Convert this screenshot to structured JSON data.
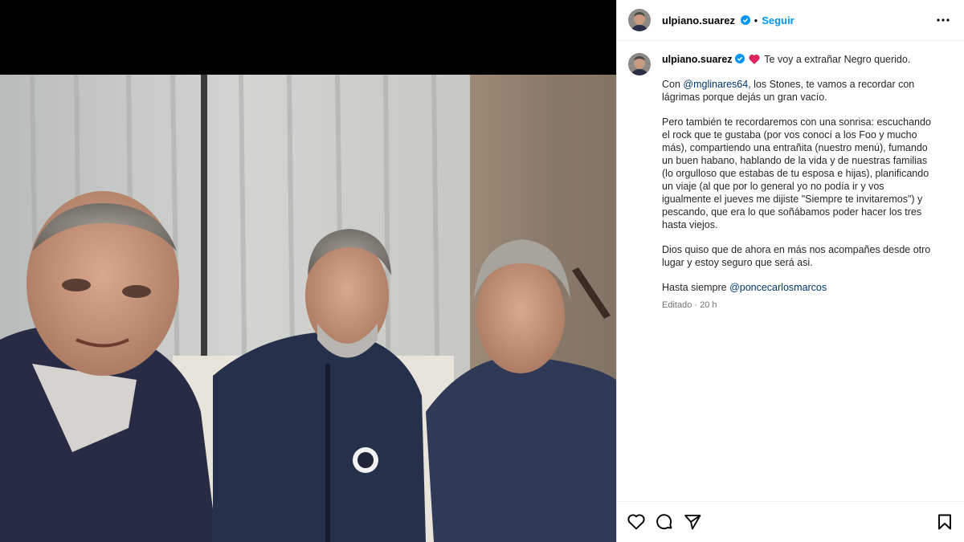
{
  "post": {
    "username": "ulpiano.suarez",
    "separator": "•",
    "follow_label": "Seguir",
    "caption": {
      "intro": "Te voy a extrañar Negro querido.",
      "p1_mention": "@mglinares64",
      "p1_rest": ", los Stones, te vamos a recordar con lágrimas porque dejás un gran vacío.",
      "p1_lead": "Con ",
      "p2": "Pero también te recordaremos con una sonrisa: escuchando el rock que te gustaba (por vos conocí a los Foo y mucho más), compartiendo una entrañita (nuestro menú), fumando un buen habano, hablando de la vida y de nuestras familias (lo orgulloso que estabas de tu esposa e hijas), planificando un viaje (al que por lo general yo no podía ir y vos igualmente el jueves me dijiste \"Siempre te invitaremos\") y pescando, que era lo que soñábamos poder hacer los tres hasta viejos.",
      "p3": "Dios quiso que de ahora en más nos acompañes desde otro lugar y estoy seguro que será asi.",
      "p4_lead": "Hasta siempre ",
      "p4_mention": "@poncecarlosmarcos"
    },
    "meta": "Editado · 20 h",
    "icons": {
      "verified": "verified-badge-icon",
      "more": "more-options-icon",
      "like": "heart-outline-icon",
      "comment": "comment-icon",
      "share": "share-paper-plane-icon",
      "save": "bookmark-icon"
    }
  },
  "colors": {
    "accent": "#0095f6",
    "mention": "#00376b",
    "meta": "#737373"
  }
}
